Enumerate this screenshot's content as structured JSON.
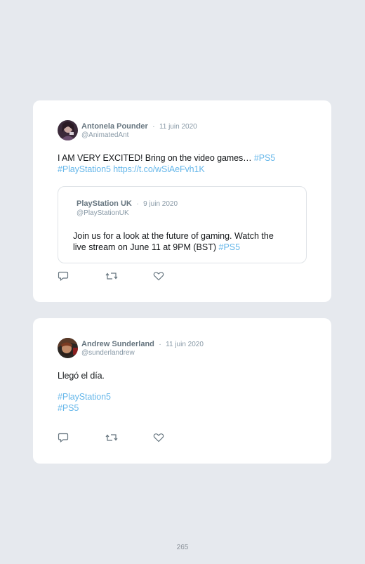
{
  "tweets": [
    {
      "author": "Antonela Pounder",
      "separator": "·",
      "date": "11 juin 2020",
      "handle": "@AnimatedAnt",
      "text_lines": [
        {
          "plain": "I AM VERY EXCITED! Bring on the video games… ",
          "link": "#PS5"
        },
        {
          "plain": "",
          "link": "#PlayStation5 https://t.co/wSiAeFvh1K"
        }
      ],
      "quoted": {
        "author": "PlayStation UK",
        "separator": "·",
        "date": "9 juin 2020",
        "handle": "@PlayStationUK",
        "line1": "Join us for a look at the future of gaming. Watch the",
        "line2_plain": "live stream on June 11 at 9PM (BST) ",
        "line2_link": "#PS5"
      },
      "actions": [
        "reply-icon",
        "retweet-icon",
        "like-icon"
      ]
    },
    {
      "author": "Andrew Sunderland",
      "separator": "·",
      "date": "11 juin 2020",
      "handle": "@sunderlandrew",
      "text": "Llegó el día.",
      "hashtags": [
        "#PlayStation5",
        "#PS5"
      ],
      "actions": [
        "reply-icon",
        "retweet-icon",
        "like-icon"
      ]
    }
  ],
  "page_number": "265",
  "colors": {
    "background": "#e6e9ee",
    "card": "#ffffff",
    "link": "#66b7ea",
    "muted": "#8899a6",
    "name": "#66757f"
  }
}
